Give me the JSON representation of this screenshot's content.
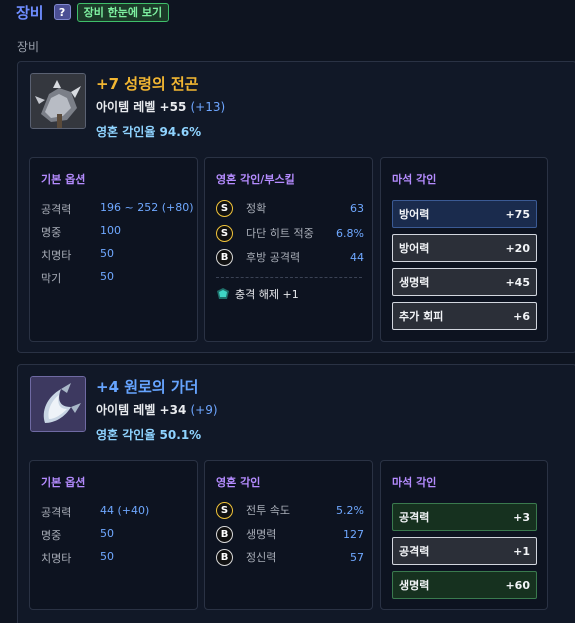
{
  "header": {
    "title": "장비",
    "help_label": "?",
    "view_all_label": "장비 한눈에 보기"
  },
  "section_label": "장비",
  "items": [
    {
      "name": "+7 성령의 전곤",
      "name_color": "#f2b632",
      "level_label": "아이템 레벨 +55",
      "level_bonus": "(+13)",
      "soul_rate": "영혼 각인율 94.6%",
      "base_title": "기본 옵션",
      "base_options": [
        {
          "label": "공격력",
          "value": "196 ~ 252",
          "delta": "(+80)"
        },
        {
          "label": "명중",
          "value": "100",
          "delta": ""
        },
        {
          "label": "치명타",
          "value": "50",
          "delta": ""
        },
        {
          "label": "막기",
          "value": "50",
          "delta": ""
        }
      ],
      "engrave_title": "영혼 각인/부스킬",
      "engravings": [
        {
          "grade": "S",
          "name": "정확",
          "value": "63"
        },
        {
          "grade": "S",
          "name": "다단 히트 적중",
          "value": "6.8%"
        },
        {
          "grade": "B",
          "name": "후방 공격력",
          "value": "44"
        }
      ],
      "set_effect": {
        "icon": "shock-release-icon",
        "label": "충격 해제",
        "value": "+1"
      },
      "mark_title": "마석 각인",
      "marks": [
        {
          "label": "방어력",
          "value": "+75",
          "style": "blue"
        },
        {
          "label": "방어력",
          "value": "+20",
          "style": "grey"
        },
        {
          "label": "생명력",
          "value": "+45",
          "style": "grey"
        },
        {
          "label": "추가 회피",
          "value": "+6",
          "style": "grey"
        }
      ]
    },
    {
      "name": "+4 원로의 가더",
      "name_color": "#66a4ff",
      "level_label": "아이템 레벨 +34",
      "level_bonus": "(+9)",
      "soul_rate": "영혼 각인율 50.1%",
      "base_title": "기본 옵션",
      "base_options": [
        {
          "label": "공격력",
          "value": "44",
          "delta": "(+40)"
        },
        {
          "label": "명중",
          "value": "50",
          "delta": ""
        },
        {
          "label": "치명타",
          "value": "50",
          "delta": ""
        }
      ],
      "engrave_title": "영혼 각인",
      "engravings": [
        {
          "grade": "S",
          "name": "전투 속도",
          "value": "5.2%"
        },
        {
          "grade": "B",
          "name": "생명력",
          "value": "127"
        },
        {
          "grade": "B",
          "name": "정신력",
          "value": "57"
        }
      ],
      "mark_title": "마석 각인",
      "marks": [
        {
          "label": "공격력",
          "value": "+3",
          "style": "green"
        },
        {
          "label": "공격력",
          "value": "+1",
          "style": "grey"
        },
        {
          "label": "생명력",
          "value": "+60",
          "style": "green"
        }
      ]
    }
  ]
}
